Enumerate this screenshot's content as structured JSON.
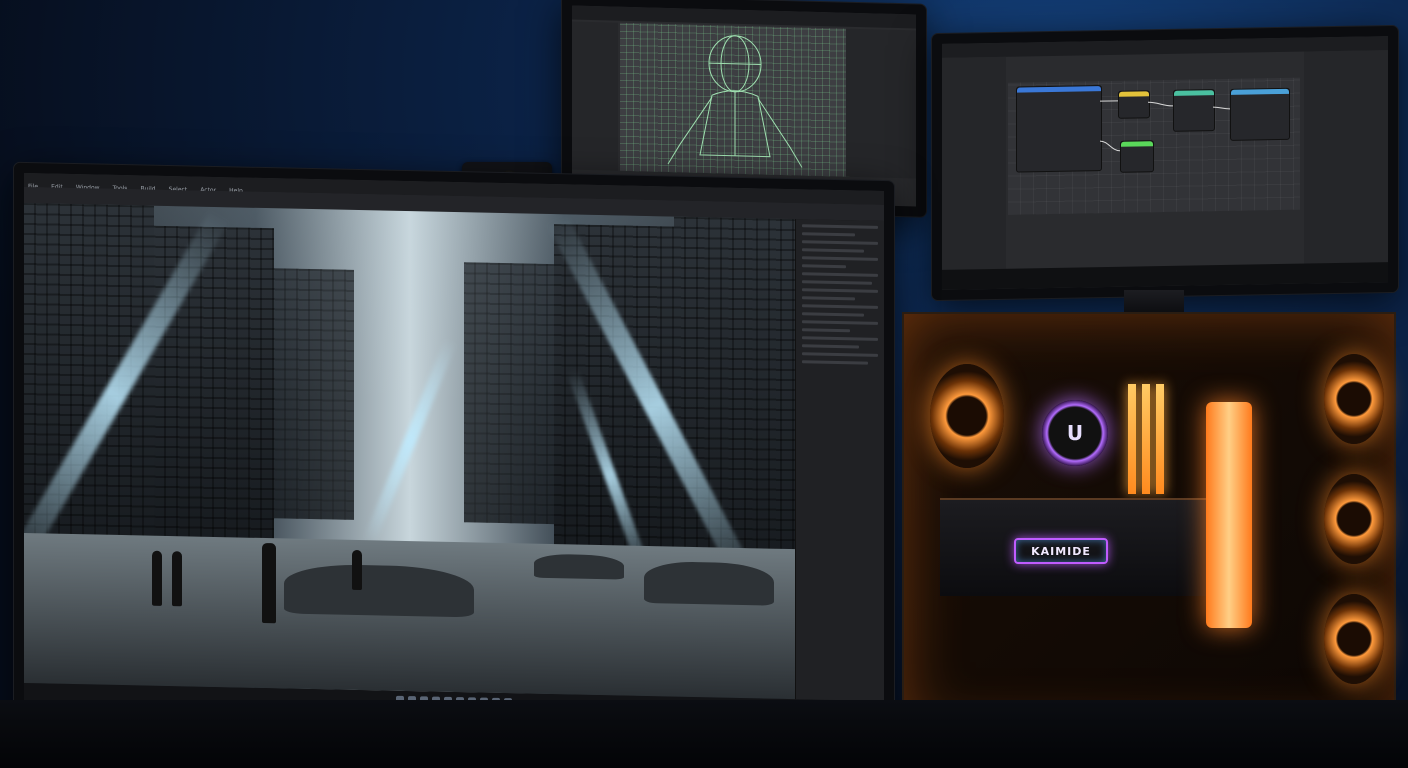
{
  "scene": {
    "description_icons": [
      "monitor-icon",
      "pc-case-icon"
    ],
    "colors": {
      "wall": "#0b2246",
      "case_glow": "#ff9a3c",
      "gpu_accent": "#c05cff",
      "wireframe": "#78c88c"
    }
  },
  "pc_case": {
    "gpu_label": "KAIMIDE",
    "pump_logo": "U"
  },
  "main_monitor": {
    "menu_items": [
      "File",
      "Edit",
      "Window",
      "Tools",
      "Build",
      "Select",
      "Actor",
      "Help"
    ]
  }
}
